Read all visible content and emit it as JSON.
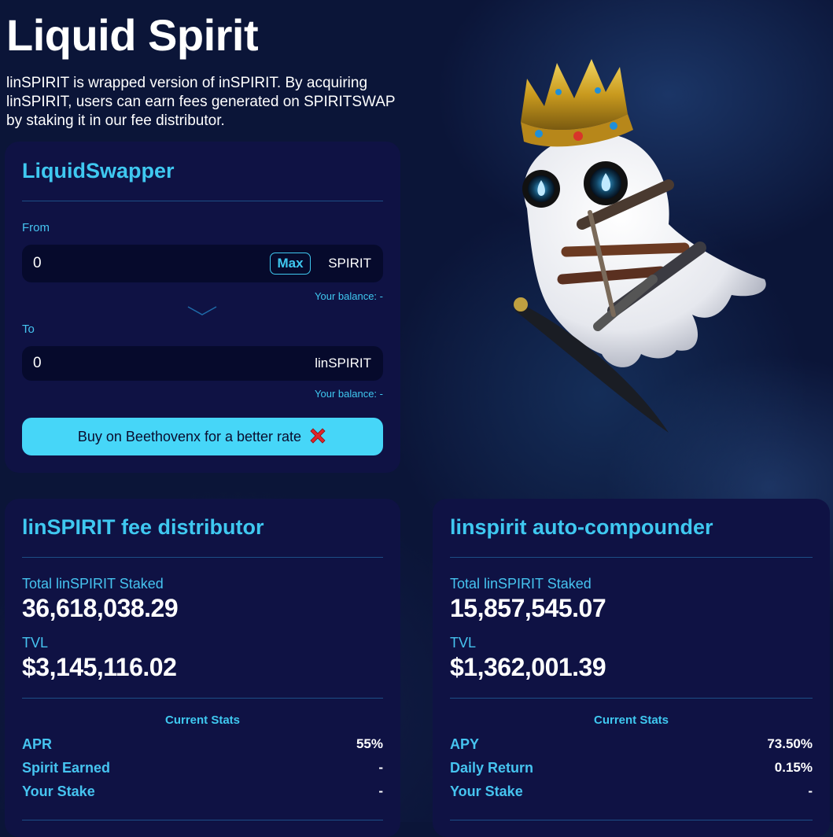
{
  "header": {
    "title": "Liquid Spirit",
    "description": "linSPIRIT is wrapped version of inSPIRIT. By acquiring linSPIRIT, users can earn fees generated on SPIRITSWAP by staking it in our fee distributor."
  },
  "swapper": {
    "title": "LiquidSwapper",
    "from_label": "From",
    "from_value": "0",
    "max_label": "Max",
    "from_token": "SPIRIT",
    "from_balance": "Your balance: -",
    "to_label": "To",
    "to_value": "0",
    "to_token": "linSPIRIT",
    "to_balance": "Your balance: -",
    "buy_label": "Buy on Beethovenx for a better rate",
    "buy_icon": "cross-mark-icon"
  },
  "fee_distributor": {
    "title": "linSPIRIT fee distributor",
    "staked_label": "Total linSPIRIT Staked",
    "staked_value": "36,618,038.29",
    "tvl_label": "TVL",
    "tvl_value": "$3,145,116.02",
    "stats_title": "Current Stats",
    "stats": [
      {
        "label": "APR",
        "value": "55%"
      },
      {
        "label": "Spirit Earned",
        "value": "-"
      },
      {
        "label": "Your Stake",
        "value": "-"
      }
    ]
  },
  "auto_compounder": {
    "title": "linspirit auto-compounder",
    "staked_label": "Total linSPIRIT Staked",
    "staked_value": "15,857,545.07",
    "tvl_label": "TVL",
    "tvl_value": "$1,362,001.39",
    "stats_title": "Current Stats",
    "stats": [
      {
        "label": "APY",
        "value": "73.50%"
      },
      {
        "label": "Daily Return",
        "value": "0.15%"
      },
      {
        "label": "Your Stake",
        "value": "-"
      }
    ]
  },
  "colors": {
    "background": "#0b1538",
    "card": "#0f1244",
    "accent": "#3fc8f0",
    "button": "#46d6f8",
    "input": "#060a2c"
  }
}
